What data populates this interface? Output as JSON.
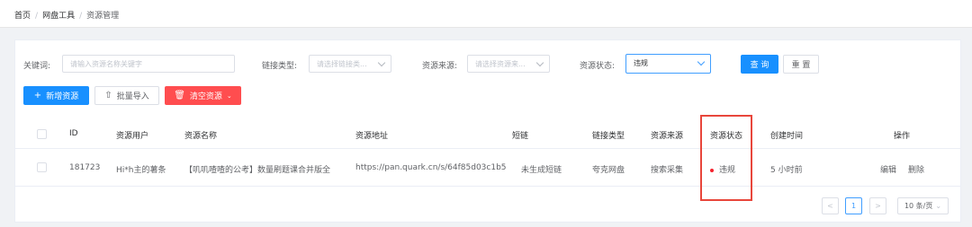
{
  "breadcrumb": {
    "home": "首页",
    "sep": "/",
    "tools": "网盘工具",
    "current": "资源管理"
  },
  "filters": {
    "keyword": {
      "label": "关键词:",
      "placeholder": "请输入资源名称关键字"
    },
    "link_type": {
      "label": "链接类型:",
      "placeholder": "请选择链接类..."
    },
    "source": {
      "label": "资源来源:",
      "placeholder": "请选择资源来..."
    },
    "status": {
      "label": "资源状态:",
      "value": "违规"
    },
    "search_label": "查 询",
    "reset_label": "重 置"
  },
  "actions": {
    "add_label": "新增资源",
    "import_label": "批量导入",
    "clear_label": "清空资源",
    "add_icon": "plus-icon",
    "import_icon": "upload-icon",
    "clear_icon": "trash-icon"
  },
  "table": {
    "columns": [
      "ID",
      "资源用户",
      "资源名称",
      "资源地址",
      "短链",
      "链接类型",
      "资源来源",
      "资源状态",
      "创建时间",
      "操作"
    ],
    "rows": [
      {
        "id": "181723",
        "user": "Hi*h主的薯条",
        "name": "【叽叽喳喳的公考】数量刷题课合并版全",
        "url": "https://pan.quark.cn/s/64f85d03c1b5",
        "short_link": "未生成短链",
        "link_type": "夸克网盘",
        "source": "搜索采集",
        "status": "违规",
        "created": "5 小时前",
        "edit": "编辑",
        "delete": "删除"
      }
    ]
  },
  "pagination": {
    "prev": "<",
    "page": "1",
    "next": ">",
    "page_size": "10 条/页"
  },
  "colors": {
    "primary": "#1890ff",
    "danger": "#ff4d4f",
    "status_dot": "#f5222d",
    "highlight": "#e8463b"
  }
}
